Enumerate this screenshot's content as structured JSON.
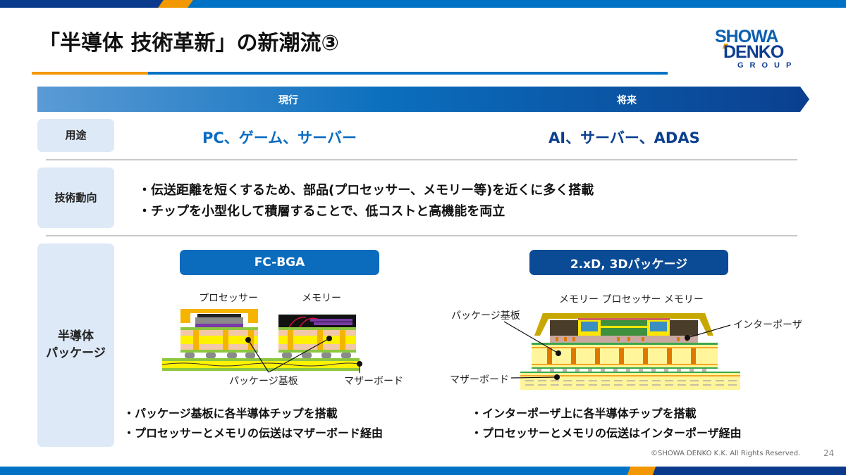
{
  "title": "「半導体 技術革新」の新潮流③",
  "logo": {
    "line1": "SHOWA",
    "line2": "DENKO",
    "line3": "GROUP"
  },
  "timeline": {
    "current_label": "現行",
    "future_label": "将来"
  },
  "rows": {
    "use": {
      "label": "用途",
      "current": "PC、ゲーム、サーバー",
      "future": "AI、サーバー、ADAS"
    },
    "trend": {
      "label": "技術動向",
      "bullets": [
        "・伝送距離を短くするため、部品(プロセッサー、メモリー等)を近くに多く搭載",
        "・チップを小型化して積層することで、低コストと高機能を両立"
      ]
    },
    "package": {
      "label_line1": "半導体",
      "label_line2": "パッケージ",
      "current": {
        "name": "FC-BGA",
        "diagram_labels": {
          "processor": "プロセッサー",
          "memory": "メモリー",
          "package_substrate": "パッケージ基板",
          "motherboard": "マザーボード"
        },
        "bullets": [
          "・パッケージ基板に各半導体チップを搭載",
          "・プロセッサーとメモリの伝送はマザーボード経由"
        ]
      },
      "future": {
        "name": "2.xD, 3Dパッケージ",
        "diagram_labels": {
          "top_chips": "メモリー プロセッサー メモリー",
          "package_substrate": "パッケージ基板",
          "interposer": "インターポーザ",
          "motherboard": "マザーボード"
        },
        "bullets": [
          "・インターポーザ上に各半導体チップを搭載",
          "・プロセッサーとメモリの伝送はインターポーザ経由"
        ]
      }
    }
  },
  "footer": {
    "copyright": "©SHOWA DENKO K.K. All Rights Reserved.",
    "page_number": "24"
  },
  "colors": {
    "brand_blue": "#0072c6",
    "brand_navy": "#0a3a8c",
    "accent_orange": "#f39800",
    "category_bg": "#dde9f6"
  }
}
